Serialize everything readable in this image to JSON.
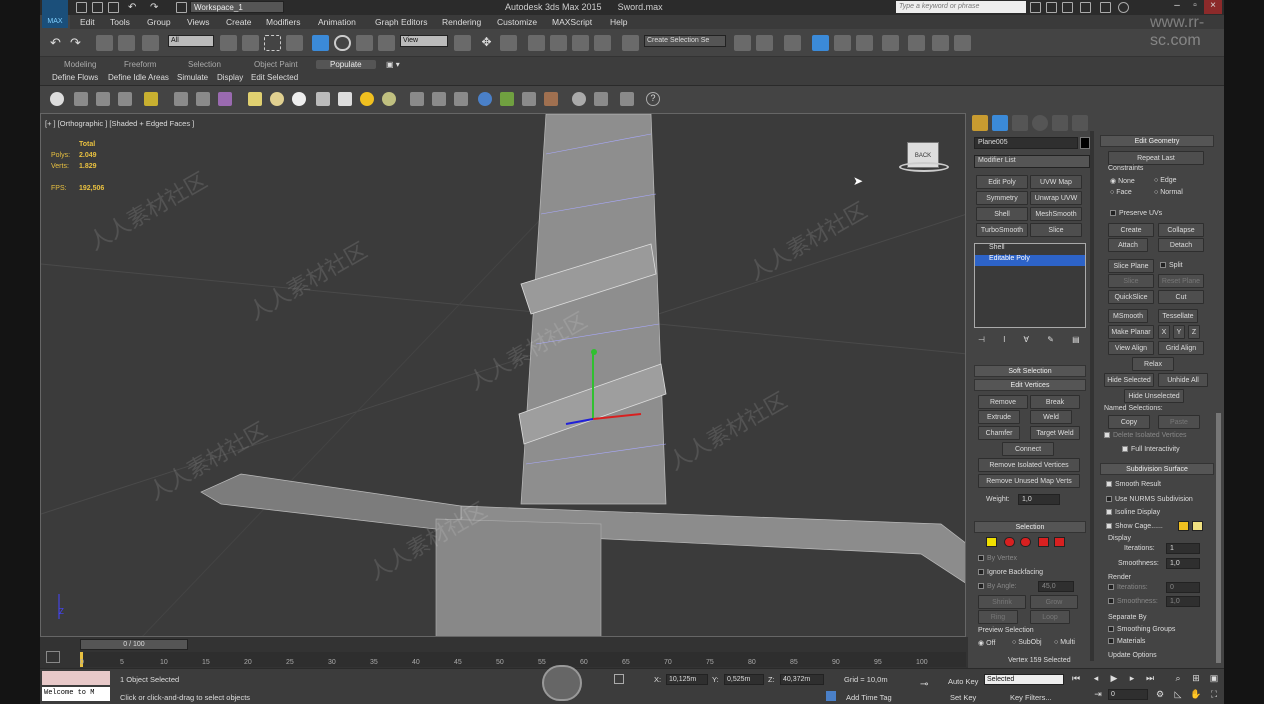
{
  "titlebar": {
    "workspace": "Workspace_1",
    "app_title": "Autodesk 3ds Max  2015",
    "file_name": "Sword.max",
    "search_placeholder": "Type a keyword or phrase",
    "logo": "MAX"
  },
  "menus": [
    "Edit",
    "Tools",
    "Group",
    "Views",
    "Create",
    "Modifiers",
    "Animation",
    "Graph Editors",
    "Rendering",
    "Customize",
    "MAXScript",
    "Help"
  ],
  "toolbar": {
    "selection_filter": "All",
    "ref_coord": "View",
    "named_selection": "Create Selection Se"
  },
  "ribbon": {
    "tabs": [
      "Modeling",
      "Freeform",
      "Selection",
      "Object Paint",
      "Populate"
    ],
    "active_tab": "Populate",
    "items": [
      "Define Flows",
      "Define Idle Areas",
      "Simulate",
      "Display",
      "Edit Selected"
    ]
  },
  "viewport": {
    "label": "[+ ] [Orthographic ] [Shaded + Edged Faces ]",
    "stats": {
      "total": "Total",
      "polys_label": "Polys:",
      "polys": "2.049",
      "verts_label": "Verts:",
      "verts": "1.829",
      "fps_label": "FPS:",
      "fps": "192,506"
    },
    "viewcube": "BACK"
  },
  "watermark": "人人素材社区",
  "cmd": {
    "object_name": "Plane005",
    "modifier_list": "Modifier List",
    "mod_buttons": [
      "Edit Poly",
      "UVW Map",
      "Symmetry",
      "Unwrap UVW",
      "Shell",
      "MeshSmooth",
      "TurboSmooth",
      "Slice"
    ],
    "stack": [
      "Shell",
      "Editable Poly"
    ],
    "soft_selection": "Soft Selection",
    "edit_vertices": "Edit Vertices",
    "ev_buttons": [
      "Remove",
      "Break",
      "Extrude",
      "Weld",
      "Chamfer",
      "Target Weld",
      "Connect",
      "Remove Isolated Vertices",
      "Remove Unused Map Verts"
    ],
    "weight_label": "Weight:",
    "weight": "1,0",
    "selection": "Selection",
    "by_vertex": "By Vertex",
    "ignore_backfacing": "Ignore Backfacing",
    "by_angle": "By Angle:",
    "angle": "45,0",
    "shrink": "Shrink",
    "grow": "Grow",
    "ring": "Ring",
    "loop": "Loop",
    "preview_selection": "Preview Selection",
    "preview_opts": [
      "Off",
      "SubObj",
      "Multi"
    ],
    "status_line": "Vertex 159 Selected",
    "edit_geometry": "Edit Geometry",
    "repeat_last": "Repeat Last",
    "constraints": "Constraints",
    "constraint_opts": [
      "None",
      "Edge",
      "Face",
      "Normal"
    ],
    "preserve_uvs": "Preserve UVs",
    "create": "Create",
    "collapse": "Collapse",
    "attach": "Attach",
    "detach": "Detach",
    "slice_plane": "Slice Plane",
    "split": "Split",
    "slice": "Slice",
    "reset_plane": "Reset Plane",
    "quickslice": "QuickSlice",
    "cut": "Cut",
    "msmooth": "MSmooth",
    "tessellate": "Tessellate",
    "make_planar": "Make Planar",
    "x": "X",
    "y": "Y",
    "z": "Z",
    "view_align": "View Align",
    "grid_align": "Grid Align",
    "relax": "Relax",
    "hide_selected": "Hide Selected",
    "unhide_all": "Unhide All",
    "hide_unselected": "Hide Unselected",
    "named_selections": "Named Selections:",
    "copy": "Copy",
    "paste": "Paste",
    "delete_isolated": "Delete Isolated Vertices",
    "full_interactivity": "Full Interactivity",
    "subdivision_surface": "Subdivision Surface",
    "smooth_result": "Smooth Result",
    "use_nurms": "Use NURMS Subdivision",
    "isoline_display": "Isoline Display",
    "show_cage": "Show Cage......",
    "display": "Display",
    "iterations": "Iterations:",
    "iter_val": "1",
    "smoothness": "Smoothness:",
    "smooth_val": "1,0",
    "render": "Render",
    "r_iter": "0",
    "r_smooth": "1,0",
    "separate_by": "Separate By",
    "smoothing_groups": "Smoothing Groups",
    "materials": "Materials",
    "update_options": "Update Options"
  },
  "timeline": {
    "slider": "0 / 100",
    "ticks": [
      "0",
      "5",
      "10",
      "15",
      "20",
      "25",
      "30",
      "35",
      "40",
      "45",
      "50",
      "55",
      "60",
      "65",
      "70",
      "75",
      "80",
      "85",
      "90",
      "95",
      "100"
    ]
  },
  "status": {
    "selected": "1 Object Selected",
    "prompt": "Click or click-and-drag to select objects",
    "listener": "Welcome to M",
    "x_label": "X:",
    "x": "10,125m",
    "y_label": "Y:",
    "y": "0,525m",
    "z_label": "Z:",
    "z": "40,372m",
    "grid": "Grid = 10,0m",
    "add_time_tag": "Add Time Tag",
    "auto_key": "Auto Key",
    "key_mode": "Selected",
    "set_key": "Set Key",
    "key_filters": "Key Filters...",
    "frame": "0"
  },
  "colors": {
    "selection_blue": "#2d63c8",
    "stats_yellow": "#e8c040",
    "cage_orange": "#f0c020",
    "cage_yellow": "#f0e080",
    "vertex_red": "#d82020"
  },
  "site_watermark": "www.rr-sc.com"
}
